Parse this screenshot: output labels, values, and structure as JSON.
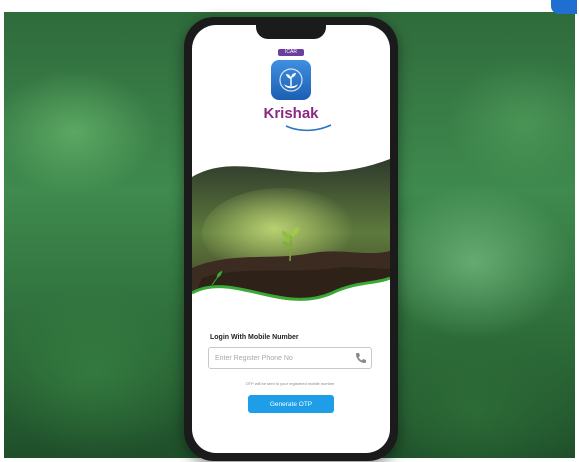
{
  "app": {
    "tag": "ICAR",
    "name": "Krishak"
  },
  "login": {
    "title": "Login With Mobile Number",
    "phone_placeholder": "Enter Register Phone No",
    "phone_value": "",
    "otp_note": "OTP will be sent to your registered mobile number",
    "button_label": "Generate OTP"
  },
  "icons": {
    "logo": "hand-plant-logo-icon",
    "phone": "phone-icon",
    "badge": "corner-badge-icon"
  },
  "colors": {
    "brand_purple": "#8a2a84",
    "button_blue": "#1e9ee8",
    "logo_blue": "#2a73c9",
    "leaf_green": "#3aa935"
  }
}
